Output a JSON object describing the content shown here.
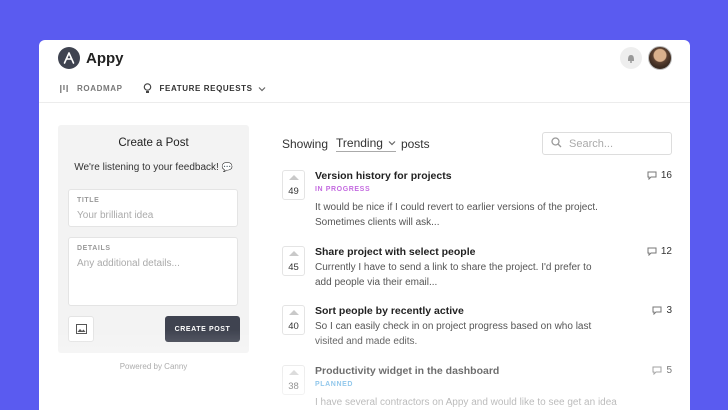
{
  "app": {
    "name": "Appy",
    "logo_icon": "logo-a-icon"
  },
  "header": {
    "notification_icon": "notification-icon",
    "avatar_icon": "user-avatar"
  },
  "nav": {
    "roadmap_label": "ROADMAP",
    "feature_requests_label": "FEATURE REQUESTS"
  },
  "create_post": {
    "title": "Create a Post",
    "subtitle": "We're listening to your feedback!",
    "title_label": "TITLE",
    "title_placeholder": "Your brilliant idea",
    "details_label": "DETAILS",
    "details_placeholder": "Any additional details...",
    "submit_label": "CREATE POST"
  },
  "powered_by": "Powered by Canny",
  "list": {
    "showing_label": "Showing",
    "sort_value": "Trending",
    "posts_label": "posts",
    "search_placeholder": "Search..."
  },
  "posts": [
    {
      "votes": "49",
      "title": "Version history for projects",
      "status": "IN PROGRESS",
      "desc_line1": "It would be nice if I could revert to earlier versions of the project.",
      "desc_line2": "Sometimes clients will ask...",
      "comments": "16"
    },
    {
      "votes": "45",
      "title": "Share project with select people",
      "status": "",
      "desc_line1": "Currently I have to send a link to share the project. I'd prefer to",
      "desc_line2": "add people via their email...",
      "comments": "12"
    },
    {
      "votes": "40",
      "title": "Sort people by recently active",
      "status": "",
      "desc_line1": "So I can easily check in on project progress based on who last",
      "desc_line2": "visited and made edits.",
      "comments": "3"
    },
    {
      "votes": "38",
      "title": "Productivity widget in the dashboard",
      "status": "PLANNED",
      "desc_line1": "I have several contractors on Appy and would like to see get an idea",
      "desc_line2": "",
      "comments": "5"
    }
  ],
  "colors": {
    "background": "#5a5bf0",
    "in_progress": "#c46be0",
    "planned": "#3a9bdc",
    "button_dark": "#3f4350"
  }
}
